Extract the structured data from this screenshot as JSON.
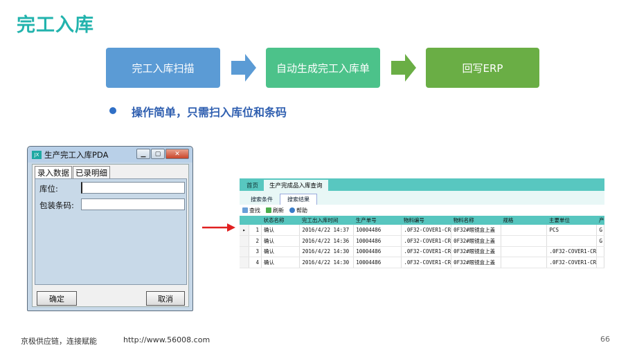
{
  "slide": {
    "title": "完工入库",
    "steps": [
      "完工入库扫描",
      "自动生成完工入库单",
      "回写ERP"
    ],
    "bullet": "操作简单，只需扫入库位和条码",
    "colors": {
      "title": "#22b3ad",
      "step1": "#5b9bd5",
      "step2": "#4cc28a",
      "step3": "#6aae45",
      "arrow1": "#5b9bd5",
      "arrow2": "#6aae45",
      "bullet": "#2f5fb0",
      "red_arrow": "#e02020"
    }
  },
  "pda": {
    "logo": "JX",
    "title": "生产完工入库PDA",
    "tabs": [
      "录入数据",
      "已录明细"
    ],
    "fields": {
      "location_label": "库位:",
      "barcode_label": "包装条码:"
    },
    "ok_label": "确定",
    "cancel_label": "取消"
  },
  "erp": {
    "tabs": [
      "首页",
      "生产完成品入库查询"
    ],
    "subtabs": [
      "搜索条件",
      "搜索结果"
    ],
    "toolbar": [
      "查找",
      "刷新",
      "帮助"
    ],
    "columns": [
      "",
      "",
      "状态名称",
      "完工出入库时间",
      "生产单号",
      "物料编号",
      "物料名称",
      "规格",
      "主要单位",
      "产"
    ],
    "rows": [
      {
        "n": "1",
        "status": "确认",
        "time": "2016/4/22  14:37",
        "order": "10004486",
        "code": ".0F32-COVER1-CR",
        "name": "0F32#眼镜盒上盖",
        "spec": "",
        "unit": "PCS",
        "extra": "G"
      },
      {
        "n": "2",
        "status": "确认",
        "time": "2016/4/22  14:36",
        "order": "10004486",
        "code": ".0F32-COVER1-CR",
        "name": "0F32#眼镜盒上盖",
        "spec": "",
        "unit": "",
        "extra": "G"
      },
      {
        "n": "3",
        "status": "确认",
        "time": "2016/4/22  14:30",
        "order": "10004486",
        "code": ".0F32-COVER1-CR",
        "name": "0F32#眼镜盒上盖",
        "spec": "",
        "unit": ".0F32-COVER1-CR",
        "extra": ""
      },
      {
        "n": "4",
        "status": "确认",
        "time": "2016/4/22  14:30",
        "order": "10004486",
        "code": ".0F32-COVER1-CR",
        "name": "0F32#眼镜盒上盖",
        "spec": "",
        "unit": ".0F32-COVER1-CR",
        "extra": ""
      }
    ]
  },
  "footer": {
    "slogan": "京极供应链，连接赋能",
    "url": "http://www.56008.com",
    "page": "66"
  }
}
